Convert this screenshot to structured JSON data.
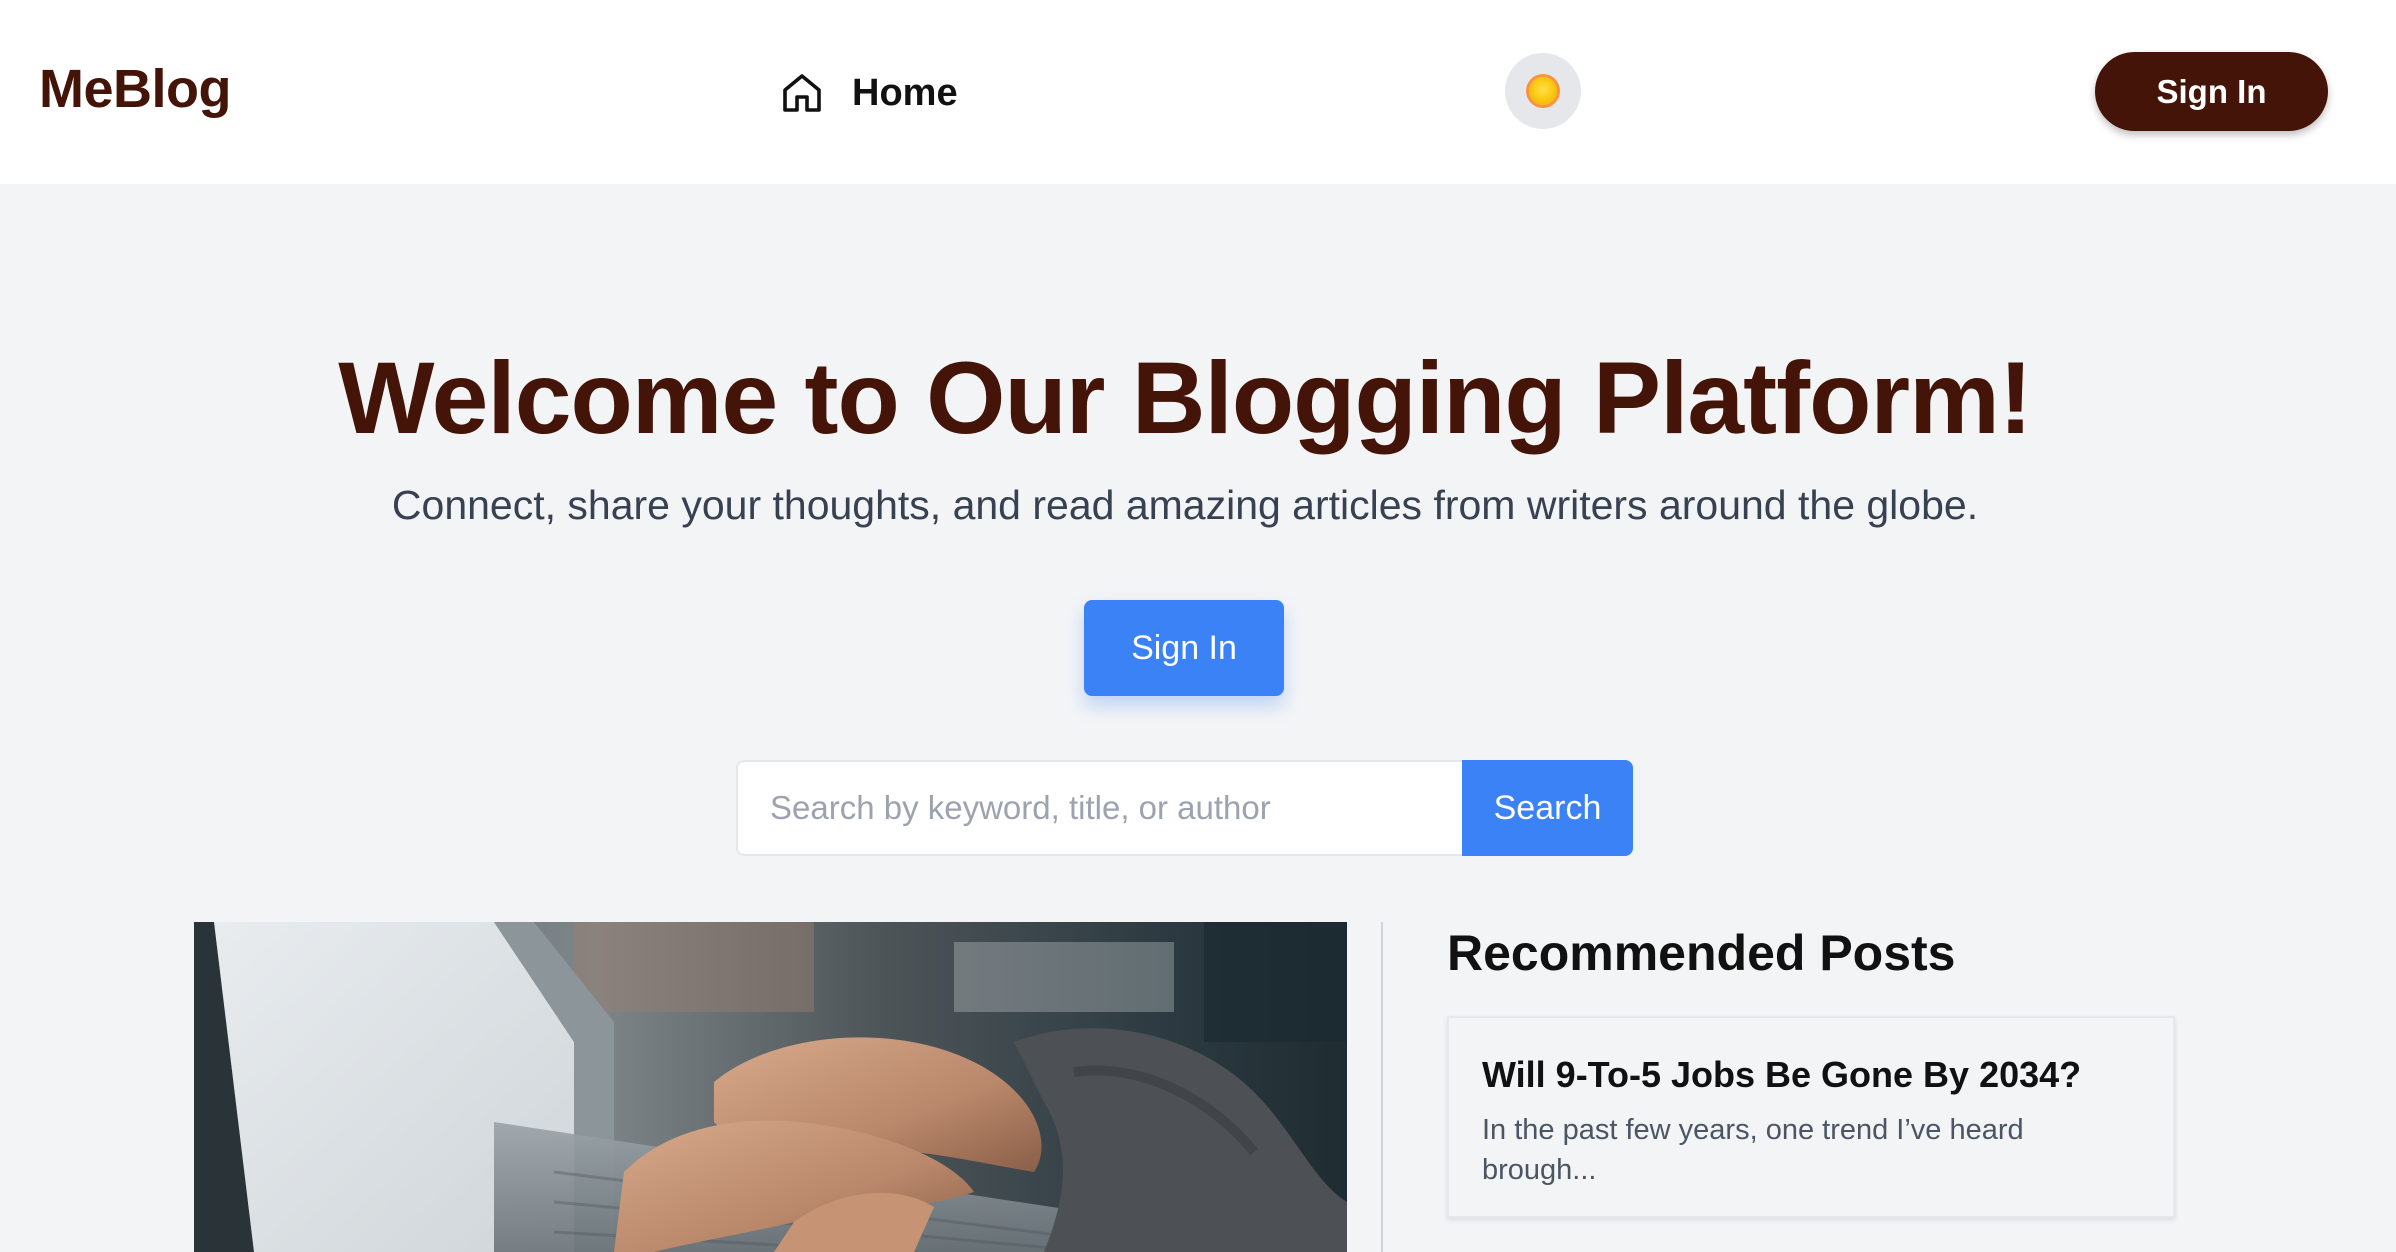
{
  "header": {
    "logo": "MeBlog",
    "nav": {
      "home_label": "Home",
      "home_icon": "home-icon"
    },
    "theme_toggle_icon": "sun-icon",
    "signin_label": "Sign In"
  },
  "hero": {
    "title": "Welcome to Our Blogging Platform!",
    "subtitle": "Connect, share your thoughts, and read amazing articles from writers around the globe.",
    "signin_label": "Sign In"
  },
  "search": {
    "placeholder": "Search by keyword, title, or author",
    "value": "",
    "button_label": "Search"
  },
  "featured": {
    "image": "laptop-typing-photo"
  },
  "recommended": {
    "heading": "Recommended Posts",
    "posts": [
      {
        "title": "Will 9-To-5 Jobs Be Gone By 2034?",
        "excerpt": "In the past few years, one trend I’ve heard brough..."
      }
    ]
  },
  "colors": {
    "brand": "#431407",
    "accent": "#3b82f6",
    "background": "#f3f4f6",
    "header_bg": "#ffffff"
  }
}
